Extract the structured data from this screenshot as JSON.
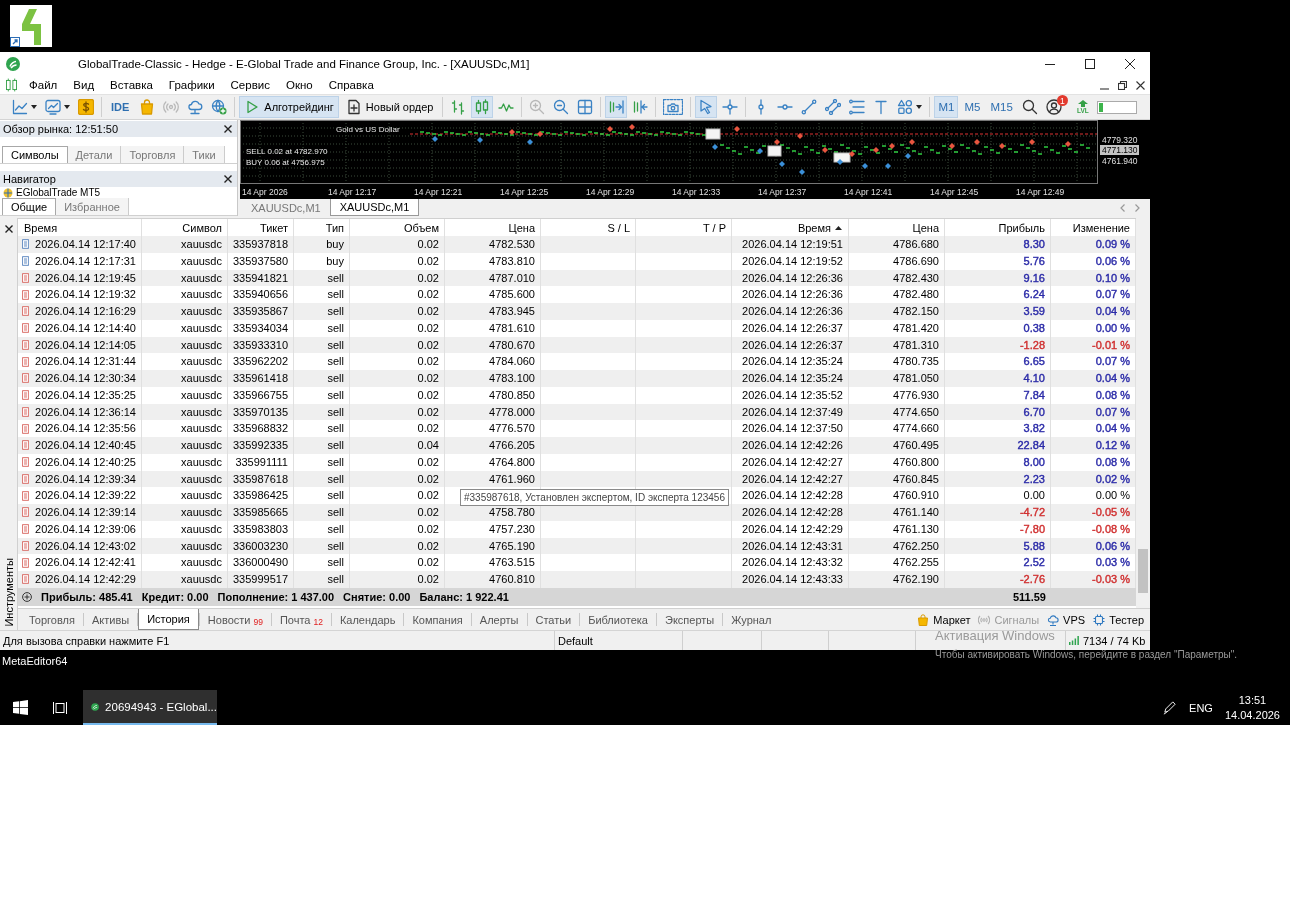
{
  "window": {
    "title": "GlobalTrade-Classic - Hedge - E-Global Trade and Finance Group, Inc. - [XAUUSDc,M1]"
  },
  "menu": [
    "Файл",
    "Вид",
    "Вставка",
    "Графики",
    "Сервис",
    "Окно",
    "Справка"
  ],
  "toolbar": {
    "ide": "IDE",
    "signals": {
      "disabled": true
    },
    "algo_trading": {
      "label": "Алготрейдинг",
      "on": true
    },
    "new_order": {
      "label": "Новый ордер"
    },
    "chart_types": [
      {
        "selected": false
      },
      {
        "selected": true
      },
      {
        "selected": false
      }
    ],
    "zoom_in": {
      "disabled": true
    },
    "autoscroll": {
      "on": true
    },
    "chart_shift": {
      "on": false
    },
    "cursor_tools": [
      {
        "selected": true
      },
      {
        "selected": false
      }
    ],
    "timeframes": [
      {
        "label": "M1",
        "selected": true
      },
      {
        "label": "M5",
        "selected": false
      },
      {
        "label": "M15",
        "selected": false
      }
    ],
    "notification_count": "1",
    "level_label": "LVL",
    "level": 0.12
  },
  "market_watch": {
    "title": "Обзор рынка: 12:51:50",
    "tabs": [
      {
        "label": "Символы",
        "selected": true
      },
      {
        "label": "Детали",
        "selected": false
      },
      {
        "label": "Торговля",
        "selected": false
      },
      {
        "label": "Тики",
        "selected": false
      }
    ]
  },
  "navigator": {
    "title": "Навигатор",
    "items": [
      {
        "label": "EGlobalTrade MT5"
      }
    ],
    "tabs": [
      {
        "label": "Общие",
        "selected": true
      },
      {
        "label": "Избранное",
        "selected": false
      }
    ]
  },
  "chart": {
    "annotations": [
      "Gold vs US Dollar",
      "SELL 0.02 at 4782.970",
      "BUY 0.06 at 4756.975"
    ],
    "price_labels": [
      {
        "label": "4779.320",
        "current": false
      },
      {
        "label": "4771.130",
        "current": true
      },
      {
        "label": "4761.940",
        "current": false
      }
    ],
    "time_labels": [
      "14 Apr 2026",
      "14 Apr 12:17",
      "14 Apr 12:21",
      "14 Apr 12:25",
      "14 Apr 12:29",
      "14 Apr 12:33",
      "14 Apr 12:37",
      "14 Apr 12:41",
      "14 Apr 12:45",
      "14 Apr 12:49"
    ],
    "tabs": [
      {
        "label": "XAUUSDc,M1",
        "selected": false
      },
      {
        "label": "XAUUSDc,M1",
        "selected": true
      }
    ]
  },
  "toolbox": {
    "title": "Инструменты",
    "table": {
      "columns": [
        {
          "label": "Время",
          "sorted": false
        },
        {
          "label": "Символ",
          "sorted": false
        },
        {
          "label": "Тикет",
          "sorted": false
        },
        {
          "label": "Тип",
          "sorted": false
        },
        {
          "label": "Объем",
          "sorted": false
        },
        {
          "label": "Цена",
          "sorted": false
        },
        {
          "label": "S / L",
          "sorted": false
        },
        {
          "label": "T / P",
          "sorted": false
        },
        {
          "label": "Время",
          "sorted": true
        },
        {
          "label": "Цена",
          "sorted": false
        },
        {
          "label": "Прибыль",
          "sorted": false
        },
        {
          "label": "Изменение",
          "sorted": false
        }
      ],
      "rows": [
        {
          "kind": "buy",
          "open_time": "2026.04.14 12:17:40",
          "symbol": "xauusdc",
          "ticket": "335937818",
          "type": "buy",
          "volume": "0.02",
          "open_price": "4782.530",
          "close_time": "2026.04.14 12:19:51",
          "close_price": "4786.680",
          "profit": "8.30",
          "change": "0.09 %",
          "color": "#2b2ba8"
        },
        {
          "kind": "buy",
          "open_time": "2026.04.14 12:17:31",
          "symbol": "xauusdc",
          "ticket": "335937580",
          "type": "buy",
          "volume": "0.02",
          "open_price": "4783.810",
          "close_time": "2026.04.14 12:19:52",
          "close_price": "4786.690",
          "profit": "5.76",
          "change": "0.06 %",
          "color": "#2b2ba8"
        },
        {
          "kind": "sell",
          "open_time": "2026.04.14 12:19:45",
          "symbol": "xauusdc",
          "ticket": "335941821",
          "type": "sell",
          "volume": "0.02",
          "open_price": "4787.010",
          "close_time": "2026.04.14 12:26:36",
          "close_price": "4782.430",
          "profit": "9.16",
          "change": "0.10 %",
          "color": "#2b2ba8"
        },
        {
          "kind": "sell",
          "open_time": "2026.04.14 12:19:32",
          "symbol": "xauusdc",
          "ticket": "335940656",
          "type": "sell",
          "volume": "0.02",
          "open_price": "4785.600",
          "close_time": "2026.04.14 12:26:36",
          "close_price": "4782.480",
          "profit": "6.24",
          "change": "0.07 %",
          "color": "#2b2ba8"
        },
        {
          "kind": "sell",
          "open_time": "2026.04.14 12:16:29",
          "symbol": "xauusdc",
          "ticket": "335935867",
          "type": "sell",
          "volume": "0.02",
          "open_price": "4783.945",
          "close_time": "2026.04.14 12:26:36",
          "close_price": "4782.150",
          "profit": "3.59",
          "change": "0.04 %",
          "color": "#2b2ba8"
        },
        {
          "kind": "sell",
          "open_time": "2026.04.14 12:14:40",
          "symbol": "xauusdc",
          "ticket": "335934034",
          "type": "sell",
          "volume": "0.02",
          "open_price": "4781.610",
          "close_time": "2026.04.14 12:26:37",
          "close_price": "4781.420",
          "profit": "0.38",
          "change": "0.00 %",
          "color": "#2b2ba8"
        },
        {
          "kind": "sell",
          "open_time": "2026.04.14 12:14:05",
          "symbol": "xauusdc",
          "ticket": "335933310",
          "type": "sell",
          "volume": "0.02",
          "open_price": "4780.670",
          "close_time": "2026.04.14 12:26:37",
          "close_price": "4781.310",
          "profit": "-1.28",
          "change": "-0.01 %",
          "color": "#d03030"
        },
        {
          "kind": "sell",
          "open_time": "2026.04.14 12:31:44",
          "symbol": "xauusdc",
          "ticket": "335962202",
          "type": "sell",
          "volume": "0.02",
          "open_price": "4784.060",
          "close_time": "2026.04.14 12:35:24",
          "close_price": "4780.735",
          "profit": "6.65",
          "change": "0.07 %",
          "color": "#2b2ba8"
        },
        {
          "kind": "sell",
          "open_time": "2026.04.14 12:30:34",
          "symbol": "xauusdc",
          "ticket": "335961418",
          "type": "sell",
          "volume": "0.02",
          "open_price": "4783.100",
          "close_time": "2026.04.14 12:35:24",
          "close_price": "4781.050",
          "profit": "4.10",
          "change": "0.04 %",
          "color": "#2b2ba8"
        },
        {
          "kind": "sell",
          "open_time": "2026.04.14 12:35:25",
          "symbol": "xauusdc",
          "ticket": "335966755",
          "type": "sell",
          "volume": "0.02",
          "open_price": "4780.850",
          "close_time": "2026.04.14 12:35:52",
          "close_price": "4776.930",
          "profit": "7.84",
          "change": "0.08 %",
          "color": "#2b2ba8"
        },
        {
          "kind": "sell",
          "open_time": "2026.04.14 12:36:14",
          "symbol": "xauusdc",
          "ticket": "335970135",
          "type": "sell",
          "volume": "0.02",
          "open_price": "4778.000",
          "close_time": "2026.04.14 12:37:49",
          "close_price": "4774.650",
          "profit": "6.70",
          "change": "0.07 %",
          "color": "#2b2ba8"
        },
        {
          "kind": "sell",
          "open_time": "2026.04.14 12:35:56",
          "symbol": "xauusdc",
          "ticket": "335968832",
          "type": "sell",
          "volume": "0.02",
          "open_price": "4776.570",
          "close_time": "2026.04.14 12:37:50",
          "close_price": "4774.660",
          "profit": "3.82",
          "change": "0.04 %",
          "color": "#2b2ba8"
        },
        {
          "kind": "sell",
          "open_time": "2026.04.14 12:40:45",
          "symbol": "xauusdc",
          "ticket": "335992335",
          "type": "sell",
          "volume": "0.04",
          "open_price": "4766.205",
          "close_time": "2026.04.14 12:42:26",
          "close_price": "4760.495",
          "profit": "22.84",
          "change": "0.12 %",
          "color": "#2b2ba8"
        },
        {
          "kind": "sell",
          "open_time": "2026.04.14 12:40:25",
          "symbol": "xauusdc",
          "ticket": "335991111",
          "type": "sell",
          "volume": "0.02",
          "open_price": "4764.800",
          "close_time": "2026.04.14 12:42:27",
          "close_price": "4760.800",
          "profit": "8.00",
          "change": "0.08 %",
          "color": "#2b2ba8"
        },
        {
          "kind": "sell",
          "open_time": "2026.04.14 12:39:34",
          "symbol": "xauusdc",
          "ticket": "335987618",
          "type": "sell",
          "volume": "0.02",
          "open_price": "4761.960",
          "close_time": "2026.04.14 12:42:27",
          "close_price": "4760.845",
          "profit": "2.23",
          "change": "0.02 %",
          "color": "#2b2ba8"
        },
        {
          "kind": "sell",
          "open_time": "2026.04.14 12:39:22",
          "symbol": "xauusdc",
          "ticket": "335986425",
          "type": "sell",
          "volume": "0.02",
          "close_time": "2026.04.14 12:42:28",
          "close_price": "4760.910",
          "profit": "0.00",
          "change": "0.00 %"
        },
        {
          "kind": "sell",
          "open_time": "2026.04.14 12:39:14",
          "symbol": "xauusdc",
          "ticket": "335985665",
          "type": "sell",
          "volume": "0.02",
          "open_price": "4758.780",
          "close_time": "2026.04.14 12:42:28",
          "close_price": "4761.140",
          "profit": "-4.72",
          "change": "-0.05 %",
          "color": "#d03030"
        },
        {
          "kind": "sell",
          "open_time": "2026.04.14 12:39:06",
          "symbol": "xauusdc",
          "ticket": "335983803",
          "type": "sell",
          "volume": "0.02",
          "open_price": "4757.230",
          "close_time": "2026.04.14 12:42:29",
          "close_price": "4761.130",
          "profit": "-7.80",
          "change": "-0.08 %",
          "color": "#d03030"
        },
        {
          "kind": "sell",
          "open_time": "2026.04.14 12:43:02",
          "symbol": "xauusdc",
          "ticket": "336003230",
          "type": "sell",
          "volume": "0.02",
          "open_price": "4765.190",
          "close_time": "2026.04.14 12:43:31",
          "close_price": "4762.250",
          "profit": "5.88",
          "change": "0.06 %",
          "color": "#2b2ba8"
        },
        {
          "kind": "sell",
          "open_time": "2026.04.14 12:42:41",
          "symbol": "xauusdc",
          "ticket": "336000490",
          "type": "sell",
          "volume": "0.02",
          "open_price": "4763.515",
          "close_time": "2026.04.14 12:43:32",
          "close_price": "4762.255",
          "profit": "2.52",
          "change": "0.03 %",
          "color": "#2b2ba8"
        },
        {
          "kind": "sell",
          "open_time": "2026.04.14 12:42:29",
          "symbol": "xauusdc",
          "ticket": "335999517",
          "type": "sell",
          "volume": "0.02",
          "open_price": "4760.810",
          "close_time": "2026.04.14 12:43:33",
          "close_price": "4762.190",
          "profit": "-2.76",
          "change": "-0.03 %",
          "color": "#d03030"
        }
      ],
      "summary": {
        "items": [
          "Прибыль: 485.41",
          "Кредит: 0.00",
          "Пополнение: 1 437.00",
          "Снятие: 0.00",
          "Баланс: 1 922.41"
        ],
        "profit": "511.59"
      }
    },
    "tooltip": "#335987618, Установлен экспертом, ID эксперта 123456",
    "tabs": [
      {
        "label": "Торговля",
        "selected": false
      },
      {
        "label": "Активы",
        "selected": false
      },
      {
        "label": "История",
        "selected": true
      },
      {
        "label": "Новости",
        "badge": "99",
        "selected": false
      },
      {
        "label": "Почта",
        "badge": "12",
        "selected": false
      },
      {
        "label": "Календарь",
        "selected": false
      },
      {
        "label": "Компания",
        "selected": false
      },
      {
        "label": "Алерты",
        "selected": false
      },
      {
        "label": "Статьи",
        "selected": false
      },
      {
        "label": "Библиотека",
        "selected": false
      },
      {
        "label": "Эксперты",
        "selected": false
      },
      {
        "label": "Журнал",
        "selected": false
      }
    ],
    "services": [
      {
        "label": "Маркет",
        "disabled": false
      },
      {
        "label": "Сигналы",
        "disabled": true
      },
      {
        "label": "VPS",
        "disabled": false
      },
      {
        "label": "Тестер",
        "disabled": false
      }
    ]
  },
  "status_bar": {
    "help": "Для вызова справки нажмите F1",
    "profile": "Default",
    "traffic": "7134 / 74 Kb"
  },
  "desktop_label": "MetaEditor64",
  "activation_notice": {
    "title": "Активация Windows",
    "text": "Чтобы активировать Windows, перейдите в раздел \"Параметры\"."
  },
  "taskbar": {
    "app": "20694943 - EGlobal...",
    "language": "ENG",
    "time": "13:51",
    "date": "14.04.2026"
  }
}
